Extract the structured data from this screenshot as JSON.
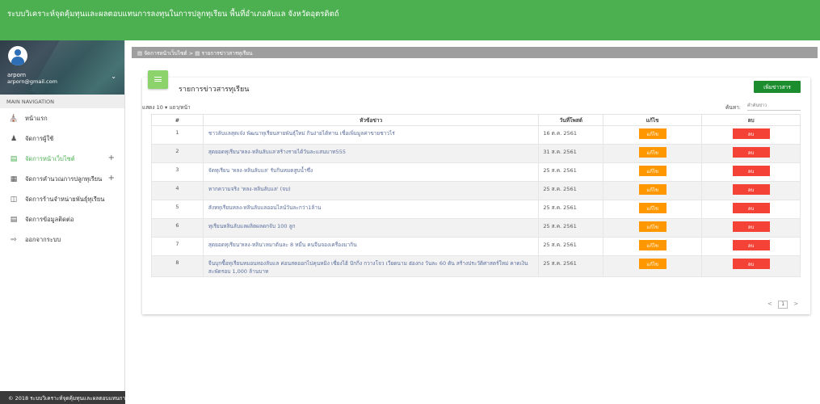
{
  "header": {
    "title": "ระบบวิเคราะห์จุดคุ้มทุนและผลตอบแทนการลงทุนในการปลูกทุเรียน พื้นที่อำเภอลับแล จังหวัดอุตรดิตถ์"
  },
  "profile": {
    "name": "arporn",
    "email": "arporn@gmail.com"
  },
  "nav": {
    "heading": "MAIN NAVIGATION",
    "items": [
      {
        "label": "หน้าแรก",
        "icon": "home-icon"
      },
      {
        "label": "จัดการผู้ใช้",
        "icon": "user-icon"
      },
      {
        "label": "จัดการหน้าเว็บไซต์",
        "icon": "browser-icon",
        "expandable": true,
        "active": true
      },
      {
        "label": "จัดการคำนวณการปลูกทุเรียน",
        "icon": "chart-icon",
        "expandable": true
      },
      {
        "label": "จัดการร้านจำหน่ายพันธุ์ทุเรียน",
        "icon": "store-icon"
      },
      {
        "label": "จัดการข้อมูลติดต่อ",
        "icon": "contact-icon"
      },
      {
        "label": "ออกจากระบบ",
        "icon": "logout-icon"
      }
    ]
  },
  "footer": {
    "text": "© 2018 ระบบวิเคราะห์จุดคุ้มทุนและผลตอบแทนการลงทุน"
  },
  "breadcrumb": {
    "item1": "จัดการหน้าเว็บไซต์",
    "sep": ">",
    "item2": "รายการข่าวสารทุเรียน"
  },
  "card": {
    "title": "รายการข่าวสารทุเรียน",
    "add_label": "เพิ่มข่าวสาร",
    "length_prefix": "แสดง",
    "length_value": "10",
    "length_suffix": "แถว/หน้า",
    "search_label": "ค้นหา:",
    "search_placeholder": "คำค้นข่าว"
  },
  "table": {
    "headers": [
      "#",
      "หัวข้อข่าว",
      "วันที่โพสต์",
      "แก้ไข",
      "ลบ"
    ],
    "edit_label": "แก้ไข",
    "delete_label": "ลบ",
    "rows": [
      {
        "num": "1",
        "title": "ชาวลับแลสุดเจ๋ง พัฒนาทุเรียนสายพันธุ์ใหม่ กินง่ายได้ทาน เชื่อเพิ่มมูลค่าขายชาวไร่",
        "date": "16 ต.ค. 2561"
      },
      {
        "num": "2",
        "title": "สุดยอดทุเรียน'หลง-หลินลับแล'สร้างรายได้วันละแสนบาท555",
        "date": "31 ส.ค. 2561"
      },
      {
        "num": "3",
        "title": "จัดทุเรียน 'หลง-หลินลับแล' รับกินหมดสูบน้ำซึ่ง",
        "date": "25 ส.ค. 2561"
      },
      {
        "num": "4",
        "title": "หากความจริง 'หลง-หลินลับแล' (จบ)",
        "date": "25 ส.ค. 2561"
      },
      {
        "num": "5",
        "title": "สังหทุเรียนหลง-หลินลับแลออนไลน์วันละกว่า1ล้าน",
        "date": "25 ส.ค. 2561"
      },
      {
        "num": "6",
        "title": "ทุเรียนหลินลับแลผลิตผลดกจับ 100 ลูก",
        "date": "25 ส.ค. 2561"
      },
      {
        "num": "7",
        "title": "สุดยอดทุเรียน'หลง-หลิน'เหมาต้นละ 8 หมื่น คนจีนจองเครื่องมากิน",
        "date": "25 ส.ค. 2561"
      },
      {
        "num": "8",
        "title": "จีนบุกซื้อทุเรียนหมอนทองลับแล ค่อนสดออกไปคุนหมิง เซี่ยงไฮ้ ปักกิ่ง กวางโจว เวียดนาม ฮ่องกง วันละ 60 ตัน สร้างประวัติศาสตร์ใหม่ คาดเงินสะพัดรอบ 1,000 ล้านบาท",
        "date": "25 ส.ค. 2561"
      }
    ]
  },
  "pagination": {
    "prev": "<",
    "page": "1",
    "next": ">"
  }
}
